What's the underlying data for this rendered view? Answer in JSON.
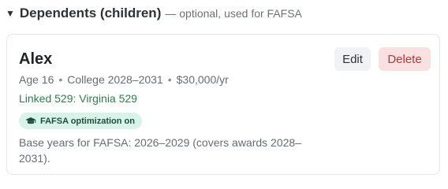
{
  "section": {
    "caret": "▼",
    "title": "Dependents (children)",
    "subtitle": "— optional, used for FAFSA"
  },
  "dependent": {
    "name": "Alex",
    "age": "Age 16",
    "college": "College 2028–2031",
    "cost": "$30,000/yr",
    "separator": "•",
    "linked_529": "Linked 529: Virginia 529",
    "fafsa_badge": "FAFSA optimization on",
    "fafsa_badge_icon": "graduation-cap-icon",
    "base_years": "Base years for FAFSA: 2026–2029 (covers awards 2028–2031).",
    "edit_label": "Edit",
    "delete_label": "Delete"
  },
  "colors": {
    "linked_529_text": "#2e7d4f",
    "badge_bg": "#d8f3ea",
    "delete_bg": "#f9e1e1",
    "delete_text": "#b6373c",
    "edit_bg": "#f1f2f4"
  }
}
